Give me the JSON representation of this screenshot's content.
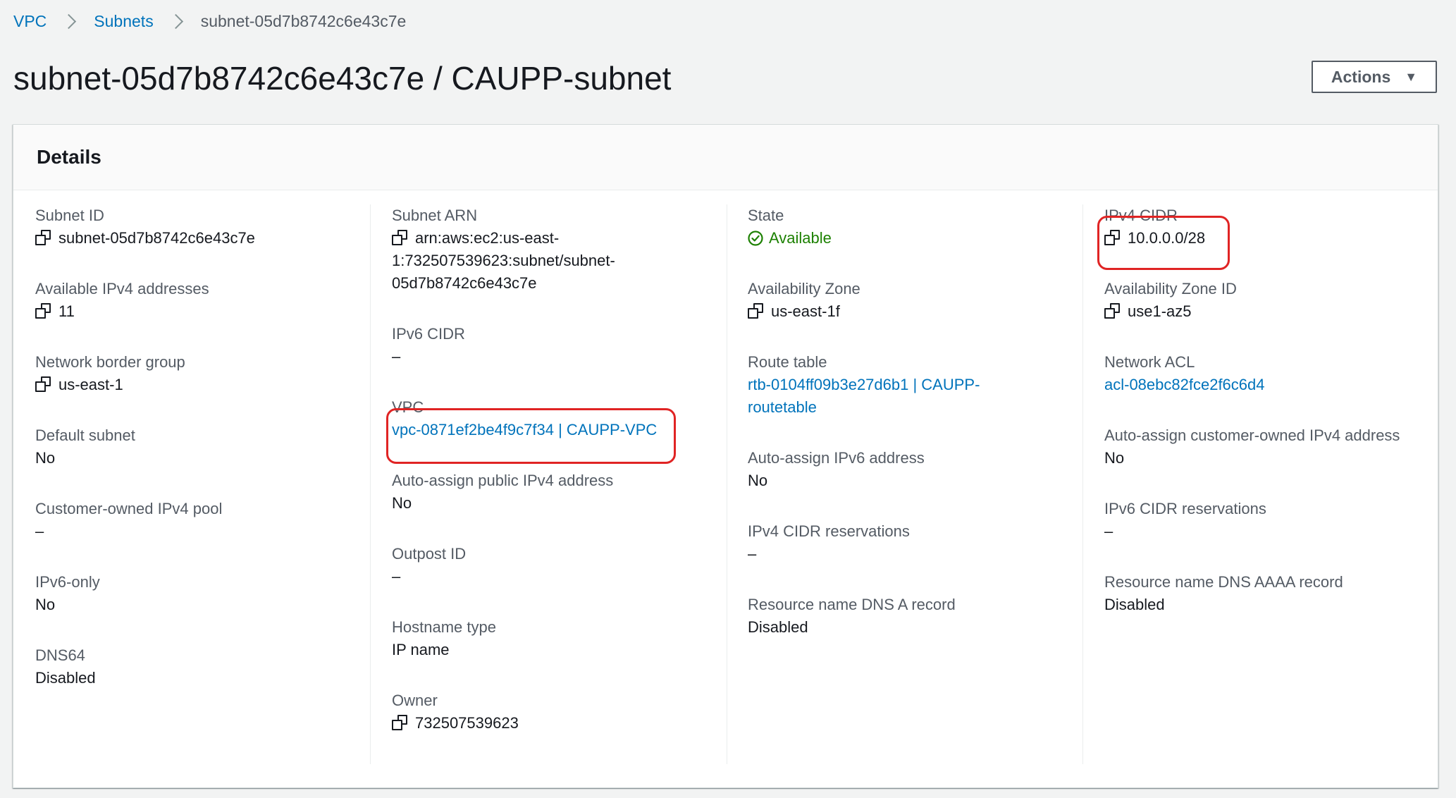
{
  "breadcrumb": {
    "items": [
      "VPC",
      "Subnets"
    ],
    "current": "subnet-05d7b8742c6e43c7e"
  },
  "page": {
    "title": "subnet-05d7b8742c6e43c7e / CAUPP-subnet",
    "actions_label": "Actions",
    "actions_caret": "▼"
  },
  "details": {
    "heading": "Details",
    "col1": [
      {
        "label": "Subnet ID",
        "value": "subnet-05d7b8742c6e43c7e"
      },
      {
        "label": "Available IPv4 addresses",
        "value": "11"
      },
      {
        "label": "Network border group",
        "value": "us-east-1"
      },
      {
        "label": "Default subnet",
        "value": "No"
      },
      {
        "label": "Customer-owned IPv4 pool",
        "value": "–"
      },
      {
        "label": "IPv6-only",
        "value": "No"
      },
      {
        "label": "DNS64",
        "value": "Disabled"
      }
    ],
    "col2": [
      {
        "label": "Subnet ARN",
        "value_lines": [
          "arn:aws:ec2:us-east-",
          "1:732507539623:subnet/subnet-",
          "05d7b8742c6e43c7e"
        ]
      },
      {
        "label": "IPv6 CIDR",
        "value": "–"
      },
      {
        "label": "VPC",
        "value": "vpc-0871ef2be4f9c7f34 | CAUPP-VPC"
      },
      {
        "label": "Auto-assign public IPv4 address",
        "value": "No"
      },
      {
        "label": "Outpost ID",
        "value": "–"
      },
      {
        "label": "Hostname type",
        "value": "IP name"
      },
      {
        "label": "Owner",
        "value": "732507539623"
      }
    ],
    "col3": [
      {
        "label": "State",
        "value": "Available"
      },
      {
        "label": "Availability Zone",
        "value": "us-east-1f"
      },
      {
        "label": "Route table",
        "value_lines": [
          "rtb-0104ff09b3e27d6b1 | CAUPP-",
          "routetable"
        ]
      },
      {
        "label": "Auto-assign IPv6 address",
        "value": "No"
      },
      {
        "label": "IPv4 CIDR reservations",
        "value": "–"
      },
      {
        "label": "Resource name DNS A record",
        "value": "Disabled"
      }
    ],
    "col4": [
      {
        "label": "IPv4 CIDR",
        "value": "10.0.0.0/28"
      },
      {
        "label": "Availability Zone ID",
        "value": "use1-az5"
      },
      {
        "label": "Network ACL",
        "value": "acl-08ebc82fce2f6c6d4"
      },
      {
        "label": "Auto-assign customer-owned IPv4 address",
        "value": "No"
      },
      {
        "label": "IPv6 CIDR reservations",
        "value": "–"
      },
      {
        "label": "Resource name DNS AAAA record",
        "value": "Disabled"
      }
    ]
  },
  "colors": {
    "link": "#0073bb",
    "success": "#1d8102",
    "annotation": "#e02424"
  },
  "icons": {
    "copy": "copy-icon",
    "status_ok": "check-circle-icon"
  }
}
